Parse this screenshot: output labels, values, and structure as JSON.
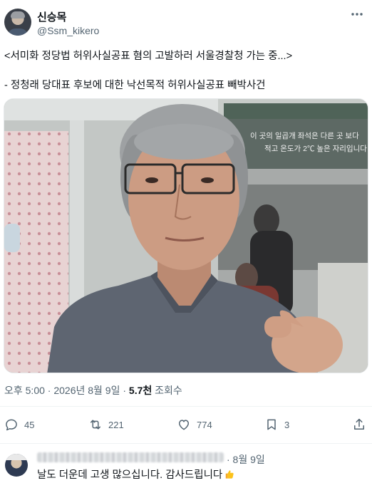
{
  "author": {
    "name": "신승목",
    "handle": "@Ssm_kikero"
  },
  "post": {
    "line1": "<서미화 정당법 허위사실공표 혐의 고발하러 서울경찰청 가는 중...>",
    "line2": "- 정청래 당대표 후보에 대한 낙선목적 허위사실공표 빼박사건",
    "timestamp": "오후 5:00 · 2026년 8월 9일 · ",
    "views_count": "5.7천",
    "views_label": " 조회수",
    "more_icon": "more-horizontal-icon"
  },
  "photo": {
    "sign_line1": "이 곳의 일곱개 좌석은 다른 곳 보다",
    "sign_line2": "적고 온도가 2℃ 높은 자리입니다",
    "colors": {
      "hair": "#9fa2a4",
      "skin": "#c99a80",
      "shirt": "#5d6470",
      "train_wall": "#c6c9c6"
    }
  },
  "actions": {
    "replies": "45",
    "reposts": "221",
    "likes": "774",
    "bookmarks": "3"
  },
  "reply": {
    "date": "· 8월 9일",
    "text": "날도 더운데 고생 많으십니다. 감사드립니다"
  },
  "colors": {
    "text": "#0f1419",
    "secondary": "#536471",
    "divider": "#eff3f4"
  }
}
